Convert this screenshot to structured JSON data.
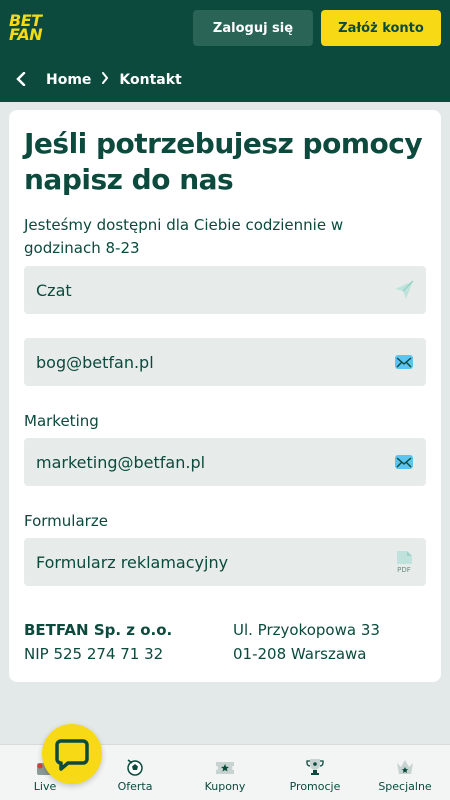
{
  "header": {
    "logo_line1": "BET",
    "logo_line2": "FAN",
    "login_label": "Zaloguj się",
    "register_label": "Załóż konto"
  },
  "breadcrumb": {
    "home": "Home",
    "current": "Kontakt"
  },
  "contact": {
    "heading": "Jeśli potrzebujesz pomocy napisz do nas",
    "subtitle": "Jesteśmy dostępni dla Ciebie codziennie w godzinach 8-23",
    "chat_label": "Czat",
    "email": "bog@betfan.pl",
    "marketing_label": "Marketing",
    "marketing_email": "marketing@betfan.pl",
    "forms_label": "Formularze",
    "form_complaint": "Formularz reklamacyjny",
    "pdf_badge": "PDF"
  },
  "company": {
    "name": "BETFAN Sp. z o.o.",
    "nip": "NIP 525 274 71 32",
    "street": "Ul. Przyokopowa 33",
    "city": "01-208 Warszawa"
  },
  "nav": {
    "items": [
      {
        "label": "Live",
        "icon": "live-icon"
      },
      {
        "label": "Oferta",
        "icon": "ball-icon"
      },
      {
        "label": "Kupony",
        "icon": "ticket-icon"
      },
      {
        "label": "Promocje",
        "icon": "trophy-icon"
      },
      {
        "label": "Specjalne",
        "icon": "crown-icon"
      }
    ]
  },
  "colors": {
    "brand_dark": "#0b4a3c",
    "brand_yellow": "#f7d916",
    "field_bg": "#e7ecea",
    "mail_icon": "#5bc4f0"
  }
}
